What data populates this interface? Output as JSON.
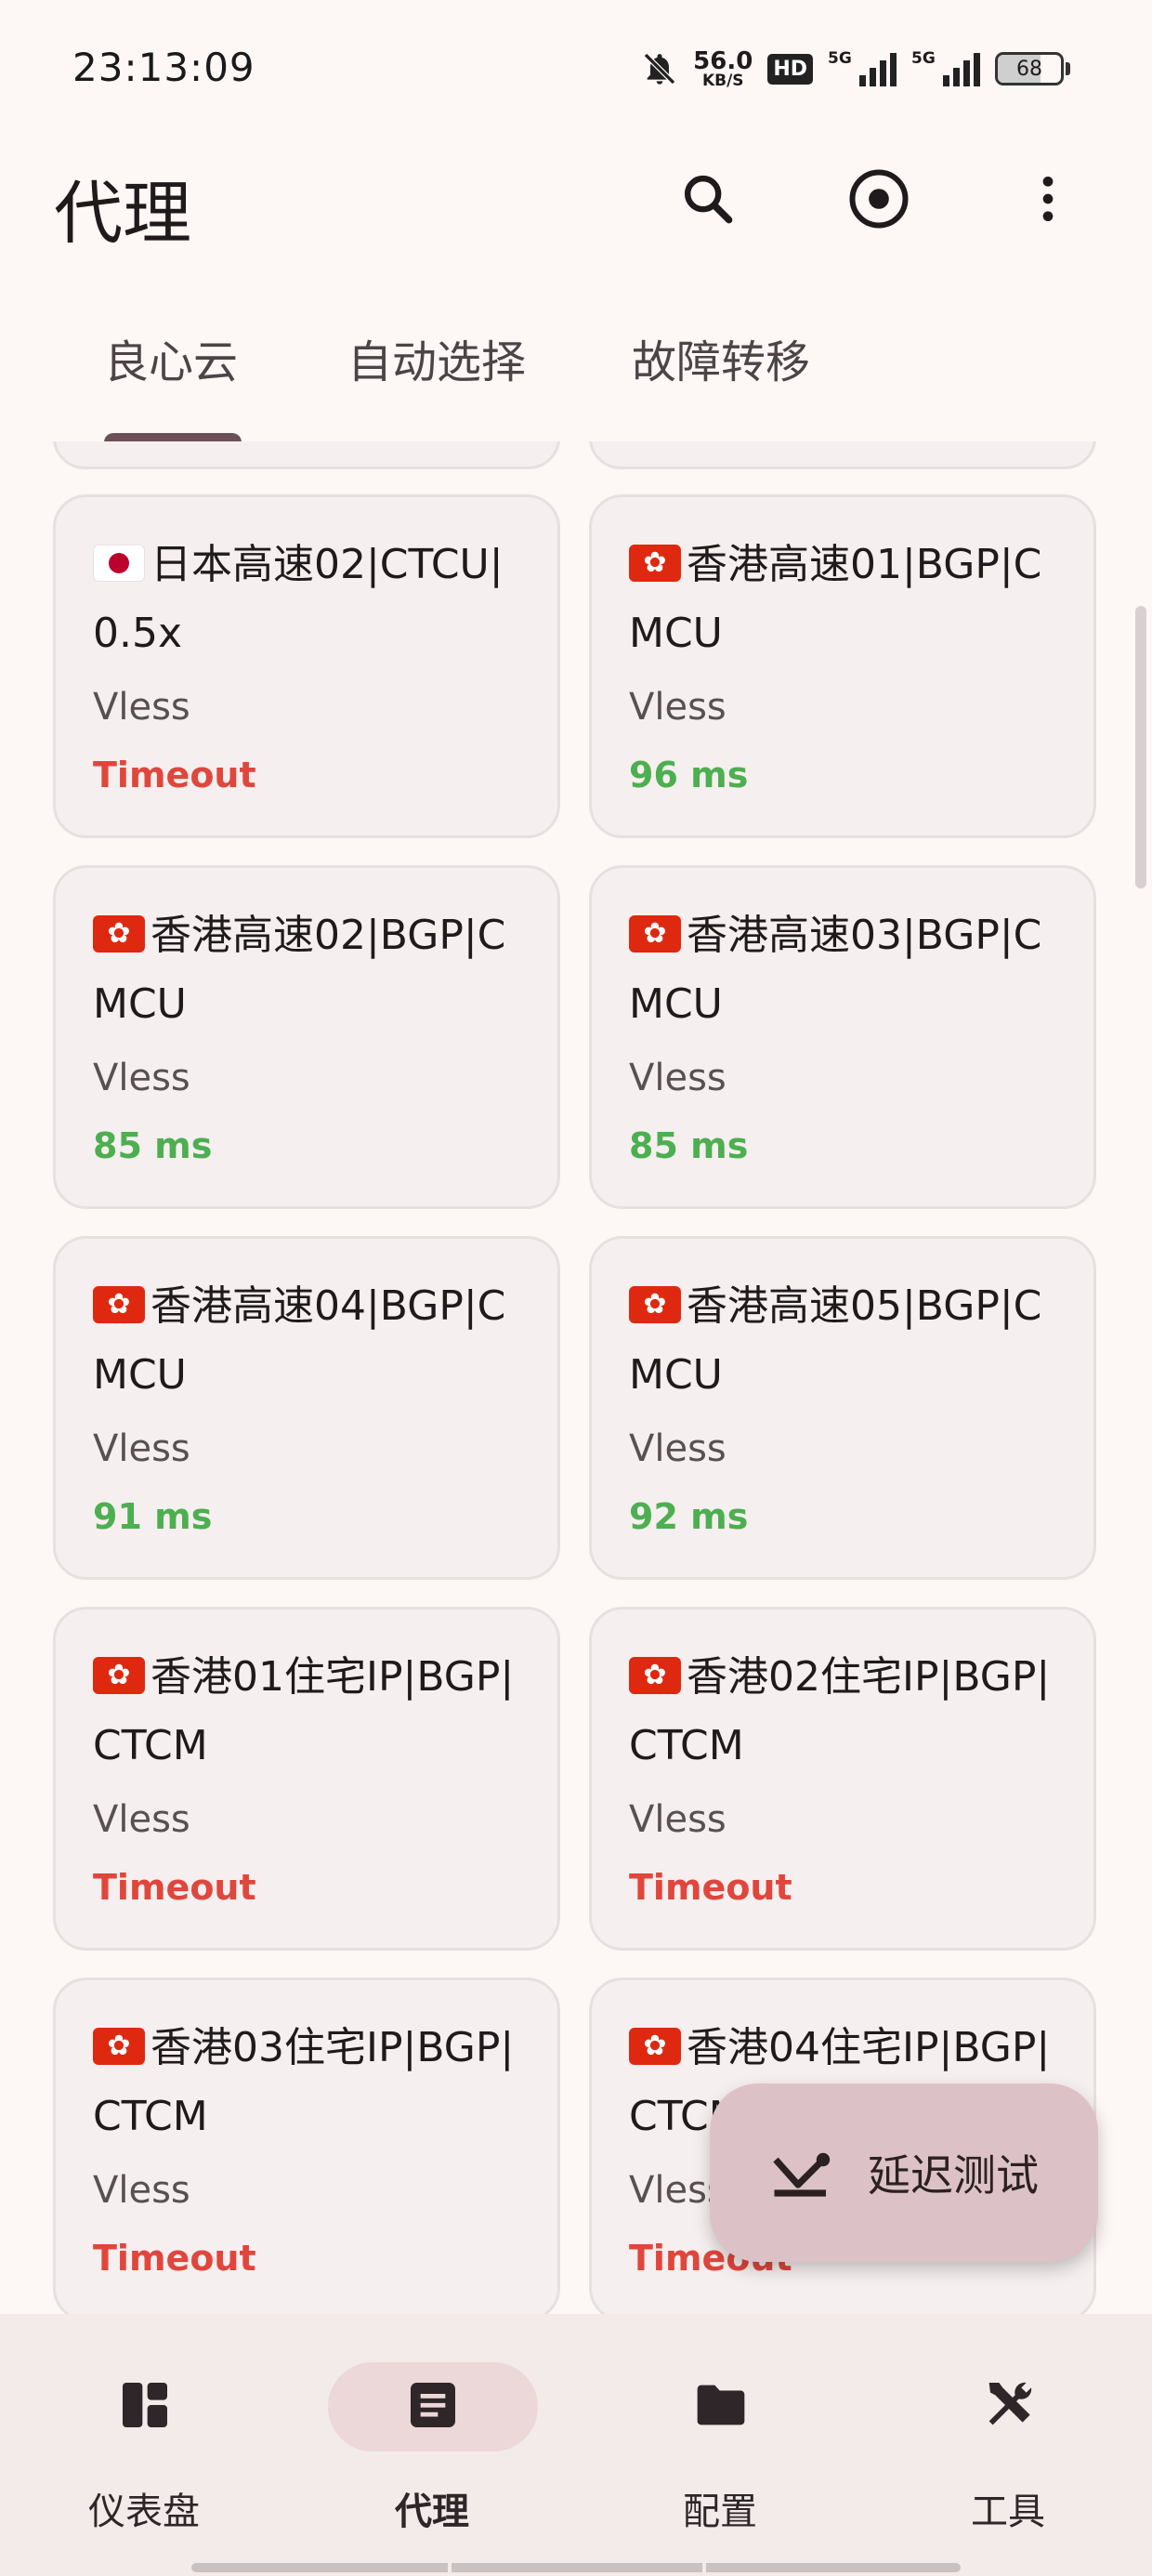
{
  "status_bar": {
    "time": "23:13:09",
    "net_speed": "56.0",
    "net_unit": "KB/S",
    "hd_badge": "HD",
    "sim1_label": "5G",
    "sim2_label": "5G",
    "battery": "68",
    "battery_level": 0.68
  },
  "app_bar": {
    "title": "代理",
    "icons": [
      "search-icon",
      "target-icon",
      "more-vert-icon"
    ]
  },
  "tabs": [
    {
      "label": "良心云",
      "active": true
    },
    {
      "label": "自动选择",
      "active": false
    },
    {
      "label": "故障转移",
      "active": false
    }
  ],
  "proxies": [
    {
      "flag": "jp",
      "name": "日本高速02|CTCU|0.5x",
      "type": "Vless",
      "delay": "Timeout",
      "status": "timeout"
    },
    {
      "flag": "hk",
      "name": "香港高速01|BGP|CMCU",
      "type": "Vless",
      "delay": "96 ms",
      "status": "ok"
    },
    {
      "flag": "hk",
      "name": "香港高速02|BGP|CMCU",
      "type": "Vless",
      "delay": "85 ms",
      "status": "ok"
    },
    {
      "flag": "hk",
      "name": "香港高速03|BGP|CMCU",
      "type": "Vless",
      "delay": "85 ms",
      "status": "ok"
    },
    {
      "flag": "hk",
      "name": "香港高速04|BGP|CMCU",
      "type": "Vless",
      "delay": "91 ms",
      "status": "ok"
    },
    {
      "flag": "hk",
      "name": "香港高速05|BGP|CMCU",
      "type": "Vless",
      "delay": "92 ms",
      "status": "ok"
    },
    {
      "flag": "hk",
      "name": "香港01住宅IP|BGP|CTCM",
      "type": "Vless",
      "delay": "Timeout",
      "status": "timeout"
    },
    {
      "flag": "hk",
      "name": "香港02住宅IP|BGP|CTCM",
      "type": "Vless",
      "delay": "Timeout",
      "status": "timeout"
    },
    {
      "flag": "hk",
      "name": "香港03住宅IP|BGP|CTCM",
      "type": "Vless",
      "delay": "Timeout",
      "status": "timeout"
    },
    {
      "flag": "hk",
      "name": "香港04住宅IP|BGP|CTCM",
      "type": "Vless",
      "delay": "Timeout",
      "status": "timeout"
    }
  ],
  "fab": {
    "label": "延迟测试",
    "icon": "speed-test-icon"
  },
  "bottom_nav": [
    {
      "label": "仪表盘",
      "icon": "dashboard-icon",
      "active": false
    },
    {
      "label": "代理",
      "icon": "article-icon",
      "active": true
    },
    {
      "label": "配置",
      "icon": "folder-icon",
      "active": false
    },
    {
      "label": "工具",
      "icon": "tools-icon",
      "active": false
    }
  ],
  "colors": {
    "background": "#fdf7f6",
    "card": "#f6efef",
    "ok": "#4caf50",
    "timeout": "#e0463c",
    "fab": "#dcc2c6",
    "active_pill": "#ecd7d9"
  }
}
